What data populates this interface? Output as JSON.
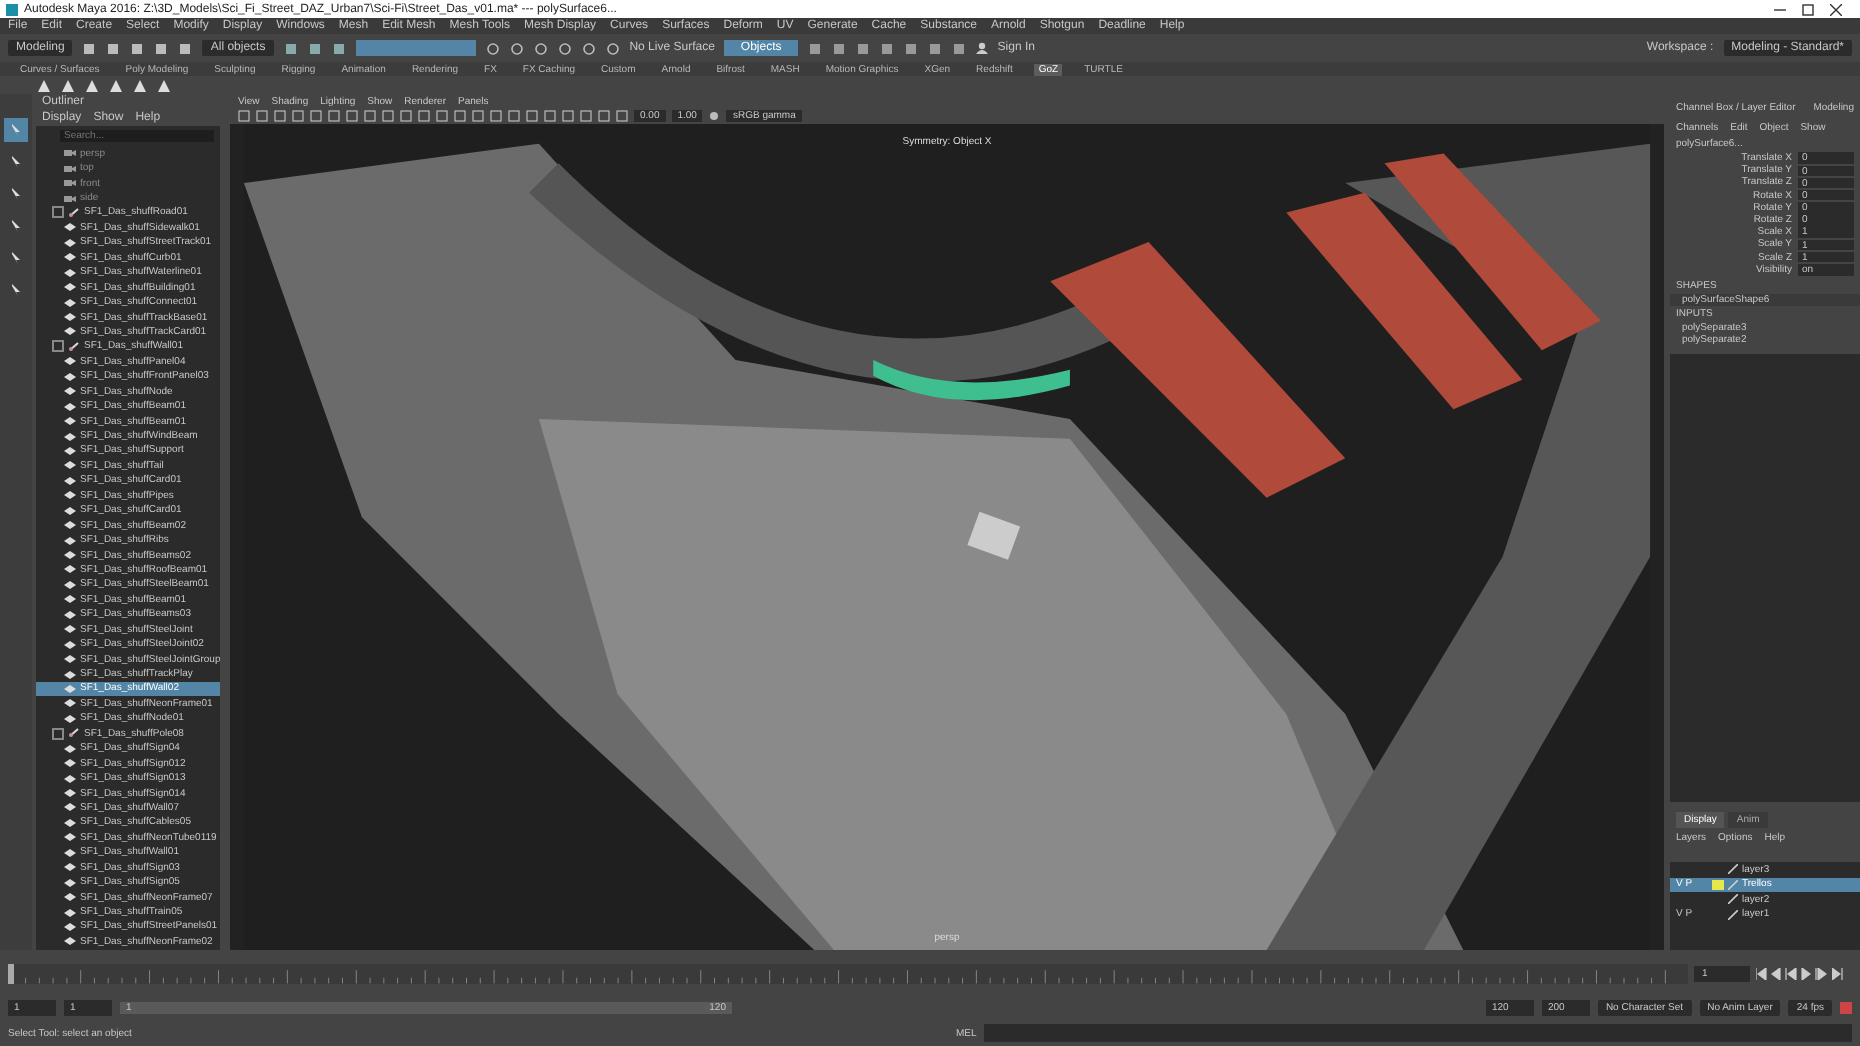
{
  "window": {
    "title": "Autodesk Maya 2016: Z:\\3D_Models\\Sci_Fi_Street_DAZ_Urban7\\Sci-Fi\\Street_Das_v01.ma*  ---  polySurface6..."
  },
  "menu_bar": [
    "File",
    "Edit",
    "Create",
    "Select",
    "Modify",
    "Display",
    "Windows",
    "Mesh",
    "Edit Mesh",
    "Mesh Tools",
    "Mesh Display",
    "Curves",
    "Surfaces",
    "Deform",
    "UV",
    "Generate",
    "Cache",
    "Substance",
    "Arnold",
    "Shotgun",
    "Deadline",
    "Help"
  ],
  "status_line": {
    "mode": "Modeling",
    "selection_mode": "All objects",
    "live_surface": "No Live Surface",
    "input_field": "Objects",
    "sign_in": "Sign In",
    "workspace_label": "Workspace :",
    "workspace": "Modeling - Standard*"
  },
  "shelf": {
    "tabs": [
      {
        "label": "Curves / Surfaces",
        "selected": false
      },
      {
        "label": "Poly Modeling",
        "selected": false
      },
      {
        "label": "Sculpting",
        "selected": false
      },
      {
        "label": "Rigging",
        "selected": false
      },
      {
        "label": "Animation",
        "selected": false
      },
      {
        "label": "Rendering",
        "selected": false
      },
      {
        "label": "FX",
        "selected": false
      },
      {
        "label": "FX Caching",
        "selected": false
      },
      {
        "label": "Custom",
        "selected": false
      },
      {
        "label": "Arnold",
        "selected": false
      },
      {
        "label": "Bifrost",
        "selected": false
      },
      {
        "label": "MASH",
        "selected": false
      },
      {
        "label": "Motion Graphics",
        "selected": false
      },
      {
        "label": "XGen",
        "selected": false
      },
      {
        "label": "Redshift",
        "selected": false
      },
      {
        "label": "GoZ",
        "selected": true
      },
      {
        "label": "TURTLE",
        "selected": false
      }
    ]
  },
  "toolbox": [
    {
      "selected": true
    },
    {
      "selected": false
    },
    {
      "selected": false
    },
    {
      "selected": false
    },
    {
      "selected": false
    },
    {
      "selected": false
    }
  ],
  "outliner": {
    "title": "Outliner",
    "menu": [
      "Display",
      "Show",
      "Help"
    ],
    "search_placeholder": "Search...",
    "items": [
      {
        "label": "persp",
        "kind": "camera",
        "selected": false
      },
      {
        "label": "top",
        "kind": "camera",
        "selected": false
      },
      {
        "label": "front",
        "kind": "camera",
        "selected": false
      },
      {
        "label": "side",
        "kind": "camera",
        "selected": false
      },
      {
        "label": "SF1_Das_shuffRoad01",
        "kind": "group",
        "selected": false
      },
      {
        "label": "SF1_Das_shuffSidewalk01",
        "kind": "mesh",
        "selected": false
      },
      {
        "label": "SF1_Das_shuffStreetTrack01",
        "kind": "mesh",
        "selected": false
      },
      {
        "label": "SF1_Das_shuffCurb01",
        "kind": "mesh",
        "selected": false
      },
      {
        "label": "SF1_Das_shuffWaterline01",
        "kind": "mesh",
        "selected": false
      },
      {
        "label": "SF1_Das_shuffBuilding01",
        "kind": "mesh",
        "selected": false
      },
      {
        "label": "SF1_Das_shuffConnect01",
        "kind": "mesh",
        "selected": false
      },
      {
        "label": "SF1_Das_shuffTrackBase01",
        "kind": "mesh",
        "selected": false
      },
      {
        "label": "SF1_Das_shuffTrackCard01",
        "kind": "mesh",
        "selected": false
      },
      {
        "label": "SF1_Das_shuffWall01",
        "kind": "group",
        "selected": false
      },
      {
        "label": "SF1_Das_shuffPanel04",
        "kind": "mesh",
        "selected": false
      },
      {
        "label": "SF1_Das_shuffFrontPanel03",
        "kind": "mesh",
        "selected": false
      },
      {
        "label": "SF1_Das_shuffNode",
        "kind": "mesh",
        "selected": false
      },
      {
        "label": "SF1_Das_shuffBeam01",
        "kind": "mesh",
        "selected": false
      },
      {
        "label": "SF1_Das_shuffBeam01",
        "kind": "mesh",
        "selected": false
      },
      {
        "label": "SF1_Das_shuffWindBeam",
        "kind": "mesh",
        "selected": false
      },
      {
        "label": "SF1_Das_shuffSupport",
        "kind": "mesh",
        "selected": false
      },
      {
        "label": "SF1_Das_shuffTail",
        "kind": "mesh",
        "selected": false
      },
      {
        "label": "SF1_Das_shuffCard01",
        "kind": "mesh",
        "selected": false
      },
      {
        "label": "SF1_Das_shuffPipes",
        "kind": "mesh",
        "selected": false
      },
      {
        "label": "SF1_Das_shuffCard01",
        "kind": "mesh",
        "selected": false
      },
      {
        "label": "SF1_Das_shuffBeam02",
        "kind": "mesh",
        "selected": false
      },
      {
        "label": "SF1_Das_shuffRibs",
        "kind": "mesh",
        "selected": false
      },
      {
        "label": "SF1_Das_shuffBeams02",
        "kind": "mesh",
        "selected": false
      },
      {
        "label": "SF1_Das_shuffRoofBeam01",
        "kind": "mesh",
        "selected": false
      },
      {
        "label": "SF1_Das_shuffSteelBeam01",
        "kind": "mesh",
        "selected": false
      },
      {
        "label": "SF1_Das_shuffBeam01",
        "kind": "mesh",
        "selected": false
      },
      {
        "label": "SF1_Das_shuffBeams03",
        "kind": "mesh",
        "selected": false
      },
      {
        "label": "SF1_Das_shuffSteelJoint",
        "kind": "mesh",
        "selected": false
      },
      {
        "label": "SF1_Das_shuffSteelJoint02",
        "kind": "mesh",
        "selected": false
      },
      {
        "label": "SF1_Das_shuffSteelJointGroup",
        "kind": "mesh",
        "selected": false
      },
      {
        "label": "SF1_Das_shuffTrackPlay",
        "kind": "mesh",
        "selected": false
      },
      {
        "label": "SF1_Das_shuffWall02",
        "kind": "mesh",
        "selected": true
      },
      {
        "label": "SF1_Das_shuffNeonFrame01",
        "kind": "mesh",
        "selected": false
      },
      {
        "label": "SF1_Das_shuffNode01",
        "kind": "mesh",
        "selected": false
      },
      {
        "label": "SF1_Das_shuffPole08",
        "kind": "group",
        "selected": false
      },
      {
        "label": "SF1_Das_shuffSign04",
        "kind": "mesh",
        "selected": false
      },
      {
        "label": "SF1_Das_shuffSign012",
        "kind": "mesh",
        "selected": false
      },
      {
        "label": "SF1_Das_shuffSign013",
        "kind": "mesh",
        "selected": false
      },
      {
        "label": "SF1_Das_shuffSign014",
        "kind": "mesh",
        "selected": false
      },
      {
        "label": "SF1_Das_shuffWall07",
        "kind": "mesh",
        "selected": false
      },
      {
        "label": "SF1_Das_shuffCables05",
        "kind": "mesh",
        "selected": false
      },
      {
        "label": "SF1_Das_shuffNeonTube0119",
        "kind": "mesh",
        "selected": false
      },
      {
        "label": "SF1_Das_shuffWall01",
        "kind": "mesh",
        "selected": false
      },
      {
        "label": "SF1_Das_shuffSign03",
        "kind": "mesh",
        "selected": false
      },
      {
        "label": "SF1_Das_shuffSign05",
        "kind": "mesh",
        "selected": false
      },
      {
        "label": "SF1_Das_shuffNeonFrame07",
        "kind": "mesh",
        "selected": false
      },
      {
        "label": "SF1_Das_shuffTrain05",
        "kind": "mesh",
        "selected": false
      },
      {
        "label": "SF1_Das_shuffStreetPanels01",
        "kind": "mesh",
        "selected": false
      },
      {
        "label": "SF1_Das_shuffNeonFrame02",
        "kind": "mesh",
        "selected": false
      }
    ]
  },
  "viewport": {
    "menu": [
      "View",
      "Shading",
      "Lighting",
      "Show",
      "Renderer",
      "Panels"
    ],
    "near": "0.00",
    "far": "1.00",
    "color_space": "sRGB gamma",
    "hud_title": "Symmetry: Object X",
    "camera_label": "persp"
  },
  "channel_box": {
    "title": "Channel Box / Layer Editor",
    "workspace_tab": "Modeling",
    "menu": [
      "Channels",
      "Edit",
      "Object",
      "Show"
    ],
    "object": "polySurface6...",
    "attributes": [
      {
        "name": "Translate X",
        "value": "0"
      },
      {
        "name": "Translate Y",
        "value": "0"
      },
      {
        "name": "Translate Z",
        "value": "0"
      },
      {
        "name": "Rotate X",
        "value": "0"
      },
      {
        "name": "Rotate Y",
        "value": "0"
      },
      {
        "name": "Rotate Z",
        "value": "0"
      },
      {
        "name": "Scale X",
        "value": "1"
      },
      {
        "name": "Scale Y",
        "value": "1"
      },
      {
        "name": "Scale Z",
        "value": "1"
      },
      {
        "name": "Visibility",
        "value": "on"
      }
    ],
    "shapes_heading": "SHAPES",
    "shapes": [
      "polySurfaceShape6"
    ],
    "inputs_heading": "INPUTS",
    "inputs": [
      "polySeparate3",
      "polySeparate2"
    ]
  },
  "layer_editor": {
    "tabs": [
      {
        "label": "Display",
        "selected": true
      },
      {
        "label": "Anim",
        "selected": false
      }
    ],
    "menu": [
      "Layers",
      "Options",
      "Help"
    ],
    "layers": [
      {
        "name": "layer3",
        "selected": false
      },
      {
        "name": "Trellos",
        "flags": "V P",
        "selected": true,
        "color": "#e6e84c"
      },
      {
        "name": "layer2",
        "selected": false
      },
      {
        "name": "layer1",
        "flags": "V P",
        "selected": false
      }
    ]
  },
  "timeline": {
    "current_frame": "1",
    "level": 0.0
  },
  "range": {
    "level": 1,
    "start": "1",
    "inner_start": "1",
    "slider_start": "1",
    "slider_end": "120",
    "inner_end": "120",
    "end": "200",
    "character_set": "No Character Set",
    "anim_layer": "No Anim Layer",
    "fps": "24 fps"
  },
  "command_line": {
    "language": "MEL"
  },
  "help_line": "Select Tool: select an object"
}
